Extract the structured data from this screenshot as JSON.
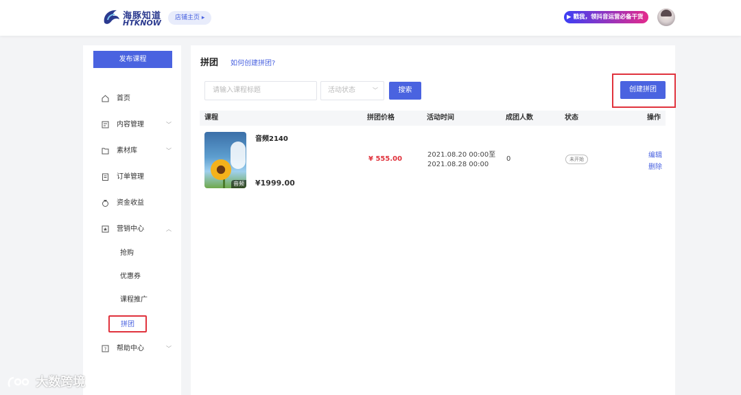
{
  "header": {
    "logo_text": "海豚知道",
    "logo_sub": "HTKNOW",
    "shop_button": "店铺主页",
    "promo_text": "▶ 戳我，领抖音运营必备干货"
  },
  "sidebar": {
    "publish_button": "发布课程",
    "items": [
      {
        "label": "首页"
      },
      {
        "label": "内容管理"
      },
      {
        "label": "素材库"
      },
      {
        "label": "订单管理"
      },
      {
        "label": "资金收益"
      },
      {
        "label": "营销中心"
      },
      {
        "label": "帮助中心"
      }
    ],
    "marketing_sub": [
      {
        "label": "抢购"
      },
      {
        "label": "优惠券"
      },
      {
        "label": "课程推广"
      },
      {
        "label": "拼团"
      }
    ]
  },
  "main": {
    "title": "拼团",
    "help_link": "如何创建拼团?",
    "search": {
      "placeholder": "请输入课程标题",
      "status_placeholder": "活动状态",
      "search_button": "搜索"
    },
    "create_button": "创建拼团",
    "table": {
      "columns": [
        "课程",
        "拼团价格",
        "活动时间",
        "成团人数",
        "状态",
        "操作"
      ],
      "rows": [
        {
          "course_name": "音频2140",
          "course_type": "音频",
          "course_price": "¥1999.00",
          "group_price": "¥ 555.00",
          "time": "2021.08.20 00:00至2021.08.28 00:00",
          "group_size": "0",
          "status": "未开始",
          "actions": [
            "编辑",
            "删除"
          ]
        }
      ]
    }
  },
  "watermark": "大数跨境",
  "colors": {
    "primary": "#4a63e0",
    "highlight": "#e0313b",
    "price": "#e0313b"
  }
}
